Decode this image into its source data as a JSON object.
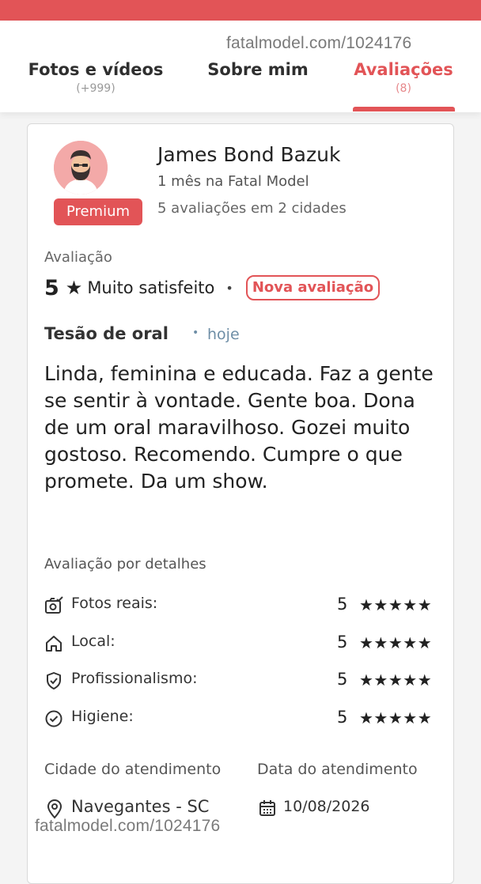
{
  "watermark": "fatalmodel.com/1024176",
  "tabs": [
    {
      "label": "Fotos e vídeos",
      "count": "(+999)"
    },
    {
      "label": "Sobre mim",
      "count": ""
    },
    {
      "label": "Avaliações",
      "count": "(8)"
    }
  ],
  "active_tab": "Avaliações",
  "reviewer": {
    "name": "James Bond Bazuk",
    "badge": "Premium",
    "tenure": "1 mês na Fatal Model",
    "review_count": "5 avaliações em 2 cidades"
  },
  "rating": {
    "label": "Avaliação",
    "score": "5",
    "star": "★",
    "text": "Muito satisfeito",
    "separator": "•",
    "new_badge": "Nova avaliação"
  },
  "review": {
    "title": "Tesão de oral",
    "date_separator": "•",
    "date": "hoje",
    "body": "Linda, feminina e educada. Faz a gente se sentir à vontade. Gente boa. Dona de um oral maravilhoso. Gozei muito gostoso. Recomendo. Cumpre o que promete. Da um show."
  },
  "details": {
    "label": "Avaliação por detalhes",
    "items": [
      {
        "icon": "camera-check-icon",
        "name": "Fotos reais:",
        "score": "5",
        "stars": "★★★★★"
      },
      {
        "icon": "home-icon",
        "name": "Local:",
        "score": "5",
        "stars": "★★★★★"
      },
      {
        "icon": "shield-check-icon",
        "name": "Profissionalismo:",
        "score": "5",
        "stars": "★★★★★"
      },
      {
        "icon": "check-circle-icon",
        "name": "Higiene:",
        "score": "5",
        "stars": "★★★★★"
      }
    ]
  },
  "service": {
    "city_label": "Cidade do atendimento",
    "city": "Navegantes - SC",
    "date_label": "Data do atendimento",
    "date": "10/08/2026"
  },
  "colors": {
    "accent": "#e25457",
    "date_text": "#6e8ea6"
  }
}
